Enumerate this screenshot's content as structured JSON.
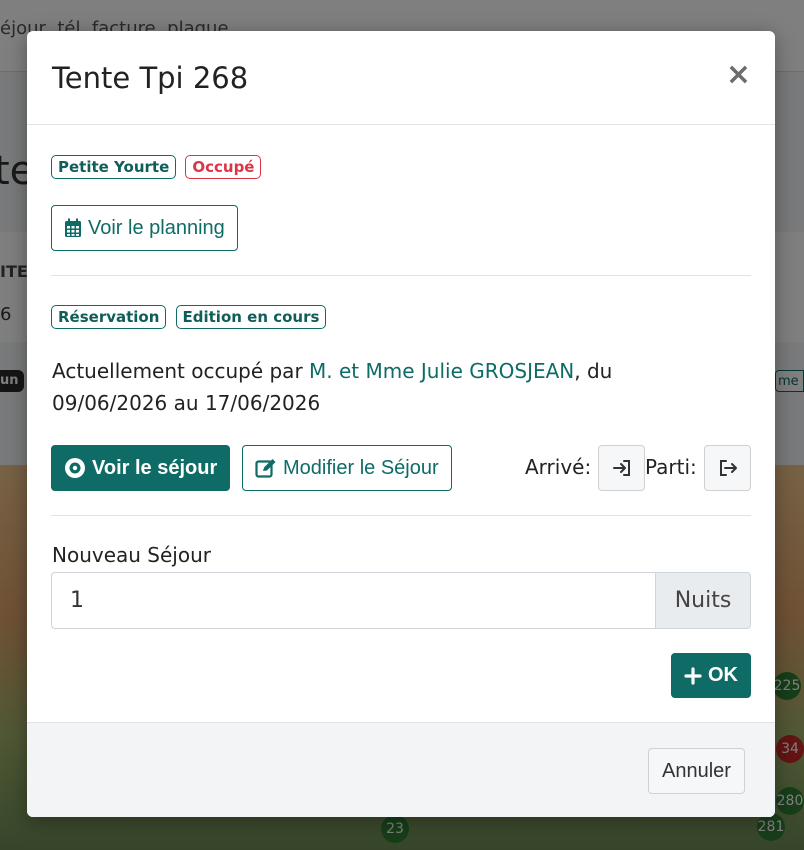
{
  "background": {
    "search_text": "éjour, tél, facture, plaque",
    "title_fragment": "te",
    "table_header_fragment": "ITE",
    "table_cell_fragment": "6",
    "pill_left": "un",
    "pill_right": "me",
    "map_numbers": [
      "23",
      "225",
      "34",
      "280",
      "281"
    ]
  },
  "modal": {
    "title": "Tente Tpi 268",
    "close_symbol": "×",
    "accommodation_badges": [
      {
        "label": "Petite Yourte"
      },
      {
        "label": "Occupé"
      }
    ],
    "planning_button": "Voir le planning",
    "stay_badges": [
      {
        "label": "Réservation"
      },
      {
        "label": "Edition en cours"
      }
    ],
    "occupancy": {
      "prefix": "Actuellement occupé par",
      "guest_name": "M. et Mme Julie GROSJEAN",
      "middle": ", du",
      "date_from": "09/06/2026",
      "date_to_prefix": "au",
      "date_to": "17/06/2026"
    },
    "view_stay_button": "Voir le séjour",
    "edit_stay_button": "Modifier le Séjour",
    "arrived_label": "Arrivé:",
    "departed_label": "Parti:",
    "new_stay_label": "Nouveau Séjour",
    "nights_value": "1",
    "nights_addon": "Nuits",
    "ok_button": "OK",
    "cancel_button": "Annuler"
  },
  "colors": {
    "primary": "#0f6b66",
    "danger": "#dc3545"
  }
}
